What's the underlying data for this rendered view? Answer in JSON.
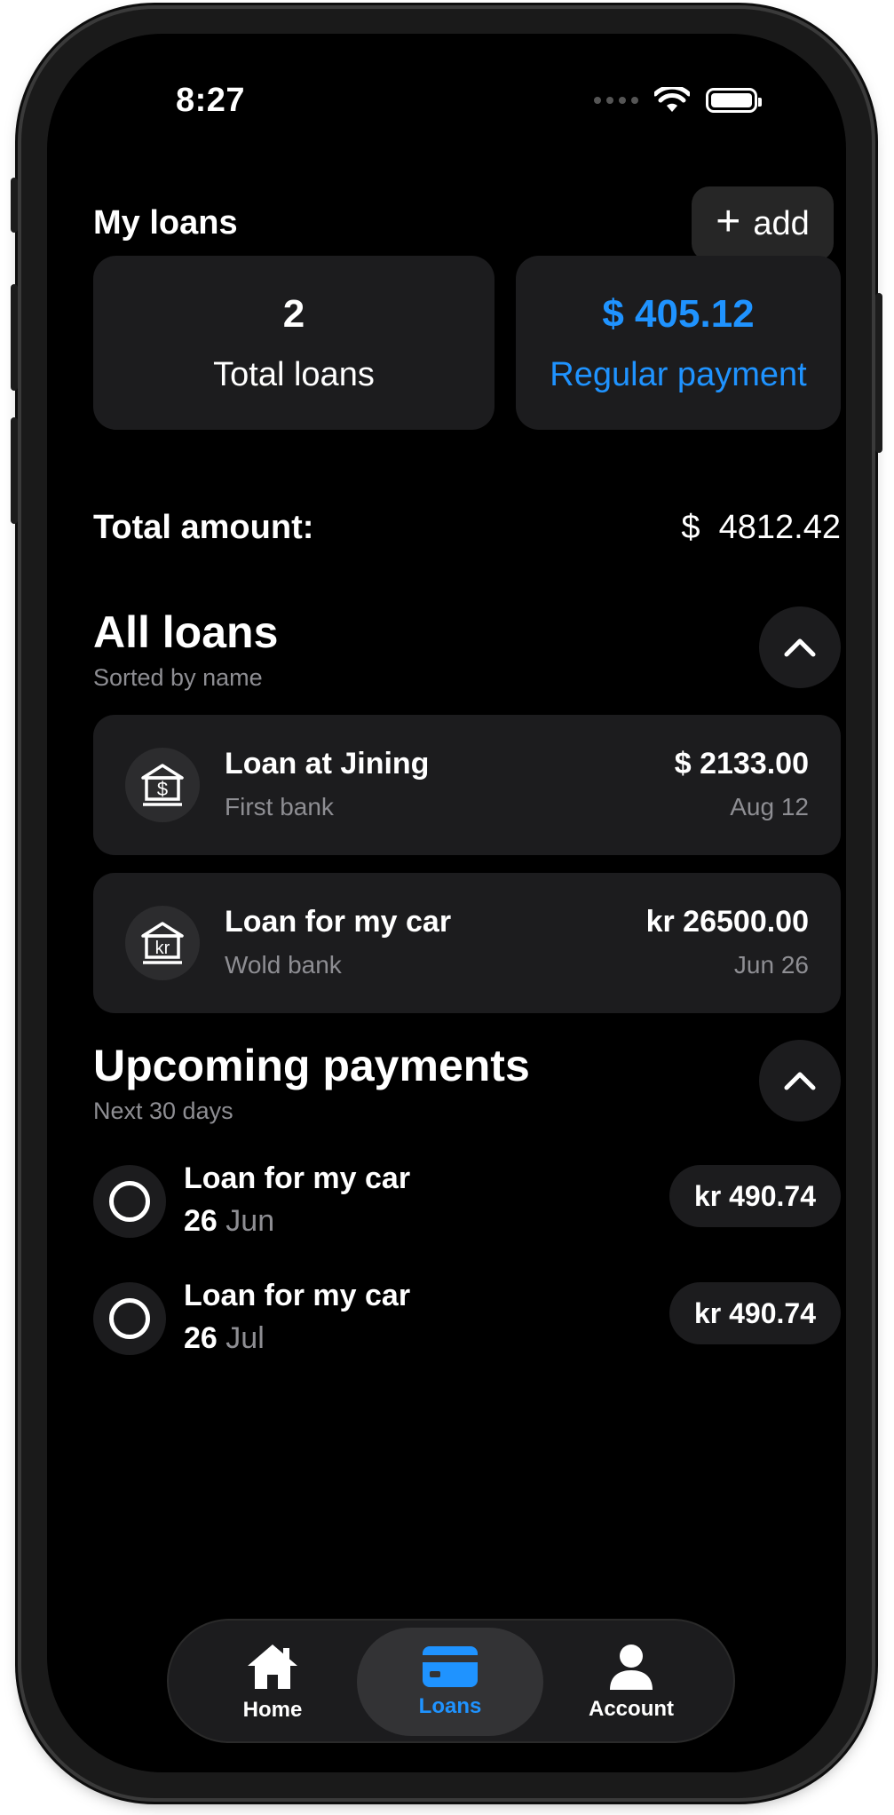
{
  "status_bar": {
    "time": "8:27"
  },
  "header": {
    "title": "My loans",
    "add_label": "add"
  },
  "summary": {
    "total_loans_value": "2",
    "total_loans_label": "Total loans",
    "regular_payment_value": "$ 405.12",
    "regular_payment_label": "Regular payment",
    "total_amount_label": "Total amount:",
    "total_amount_currency": "$",
    "total_amount_value": "4812.42"
  },
  "all_loans": {
    "title": "All loans",
    "subtitle": "Sorted by name",
    "items": [
      {
        "name": "Loan at Jining",
        "bank": "First bank",
        "amount": "$ 2133.00",
        "date": "Aug 12",
        "icon": "bank-dollar-icon",
        "icon_symbol": "$"
      },
      {
        "name": "Loan for my car",
        "bank": "Wold bank",
        "amount": "kr 26500.00",
        "date": "Jun 26",
        "icon": "bank-krone-icon",
        "icon_symbol": "kr"
      }
    ]
  },
  "upcoming": {
    "title": "Upcoming payments",
    "subtitle": "Next 30 days",
    "items": [
      {
        "name": "Loan for my car",
        "day": "26",
        "month": "Jun",
        "amount": "kr 490.74"
      },
      {
        "name": "Loan for my car",
        "day": "26",
        "month": "Jul",
        "amount": "kr 490.74"
      }
    ]
  },
  "tabbar": {
    "items": [
      {
        "label": "Home",
        "icon": "house-icon",
        "active": false
      },
      {
        "label": "Loans",
        "icon": "card-icon",
        "active": true
      },
      {
        "label": "Account",
        "icon": "person-icon",
        "active": false
      }
    ]
  },
  "colors": {
    "accent": "#1f93ff",
    "background": "#000000",
    "card": "#1c1c1e",
    "muted": "#8e8e93"
  }
}
